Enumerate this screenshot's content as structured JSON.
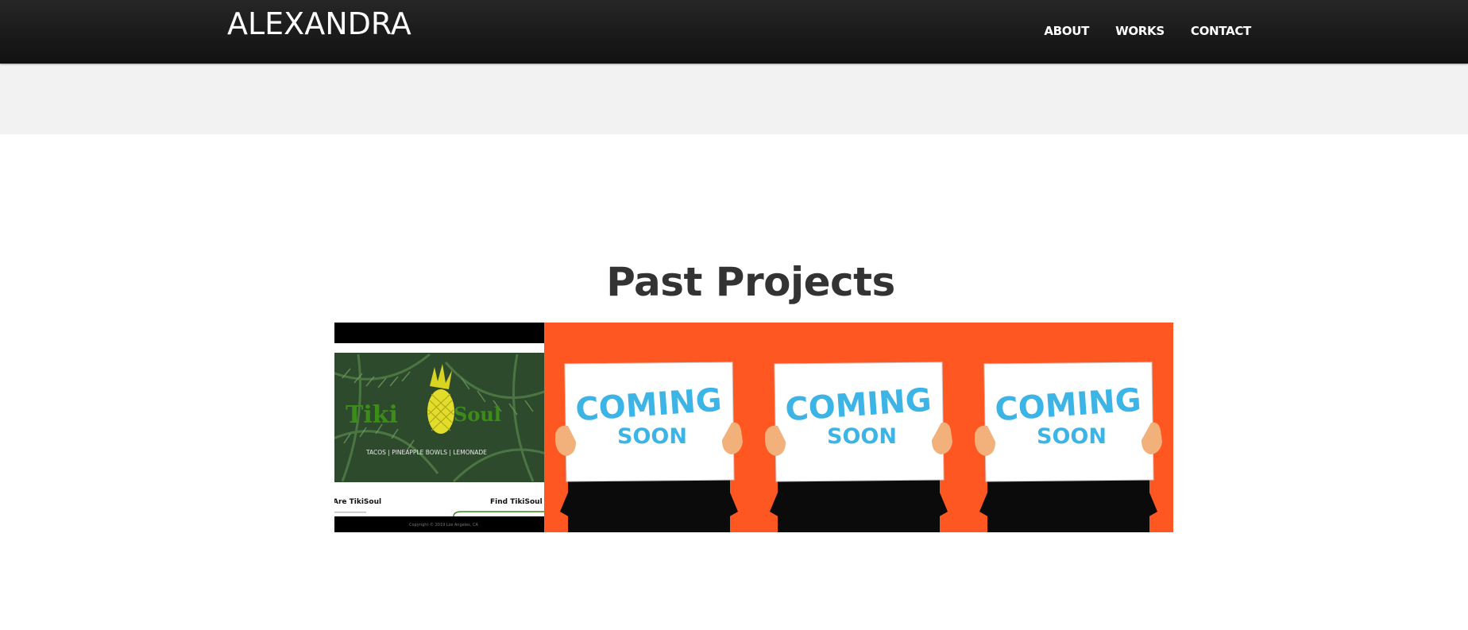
{
  "header": {
    "brand": "ALEXANDRA",
    "nav": [
      {
        "label": "ABOUT"
      },
      {
        "label": "WORKS"
      },
      {
        "label": "CONTACT"
      }
    ]
  },
  "main": {
    "title": "Past Projects",
    "projects": [
      {
        "kind": "tikisoul",
        "logo": "Tiki Soul",
        "tagline": "TACOS | PINEAPPLE BOWLS | LEMONADE",
        "left_heading": "Are TikiSoul",
        "right_heading": "Find TikiSoul",
        "footer": "Copyright © 2019 Los Angeles, CA"
      },
      {
        "kind": "coming-soon",
        "line1": "COMING",
        "line2": "SOON"
      },
      {
        "kind": "coming-soon",
        "line1": "COMING",
        "line2": "SOON"
      },
      {
        "kind": "coming-soon",
        "line1": "COMING",
        "line2": "SOON"
      }
    ]
  },
  "colors": {
    "header_bg": "#1a1a1a",
    "band_bg": "#f2f2f2",
    "coming_soon_bg": "#ff5722",
    "coming_soon_text": "#3cb4e6",
    "tiki_green": "#3c8c1a",
    "pineapple_yellow": "#e2dc2a"
  }
}
